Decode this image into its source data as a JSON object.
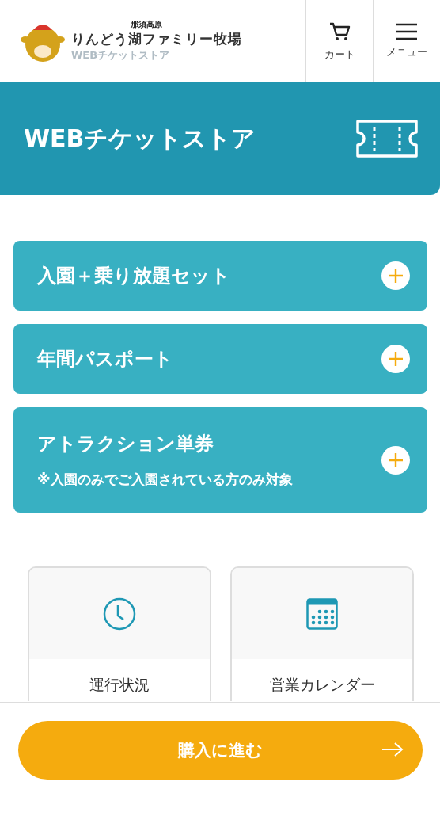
{
  "header": {
    "region_label": "那須高原",
    "title": "りんどう湖ファミリー牧場",
    "subtitle": "WEBチケットストア"
  },
  "nav_buttons": [
    {
      "label": "カート",
      "kind": "cart"
    },
    {
      "label": "メニュー",
      "kind": "menu"
    }
  ],
  "banner": {
    "title": "WEBチケットストア"
  },
  "ticket_sections": [
    {
      "title": "入園＋乗り放題セット",
      "expanded": false
    },
    {
      "title": "年間パスポート",
      "expanded": false
    },
    {
      "title": "アトラクション単券",
      "note": "※入園のみでご入園されている方のみ対象",
      "expanded": false
    }
  ],
  "info_cards": [
    {
      "label": "運行状況",
      "kind": "clock"
    },
    {
      "label": "営業カレンダー",
      "kind": "calendar"
    }
  ],
  "purchase_button": {
    "label": "購入に進む"
  }
}
